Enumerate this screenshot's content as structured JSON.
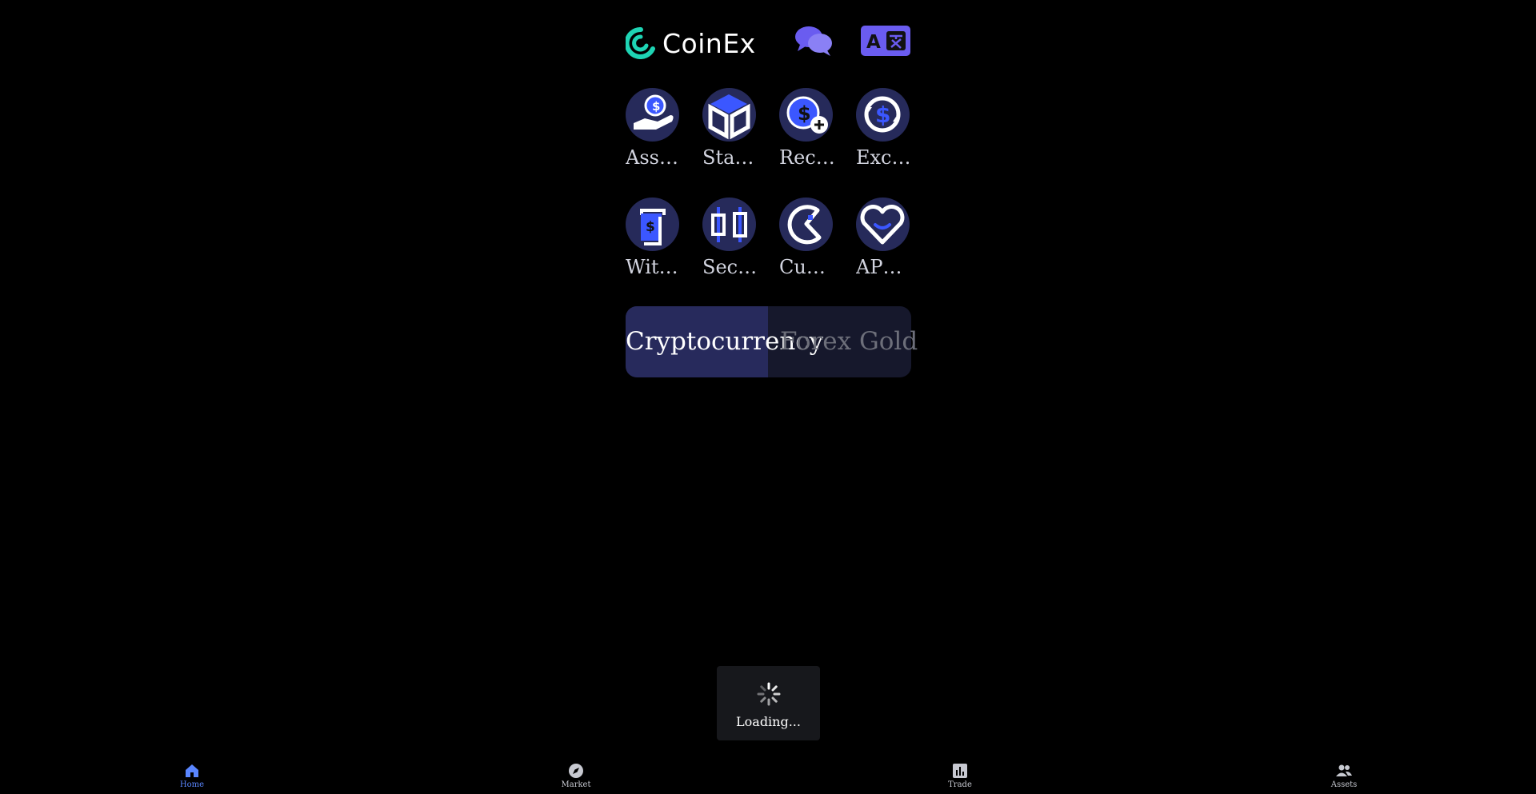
{
  "header": {
    "logo_text": "CoinEx",
    "logo_icon": "coinex-logo-icon",
    "chat_icon": "chat-bubbles-icon",
    "language_icon": "translate-icon"
  },
  "grid": {
    "items": [
      {
        "label": "Assets",
        "icon": "hand-coin-icon"
      },
      {
        "label": "Sta…",
        "icon": "cube-icon"
      },
      {
        "label": "Rec…",
        "icon": "coin-plus-icon"
      },
      {
        "label": "Exc…",
        "icon": "exchange-icon"
      },
      {
        "label": "Wit…",
        "icon": "withdraw-icon"
      },
      {
        "label": "Sec…",
        "icon": "candlestick-icon"
      },
      {
        "label": "Cus…",
        "icon": "pie-icon"
      },
      {
        "label": "AP…",
        "icon": "heart-icon"
      }
    ]
  },
  "tabs": {
    "items": [
      {
        "label": "Cryptocurrency",
        "active": true
      },
      {
        "label": "Forex Gold",
        "active": false
      }
    ]
  },
  "loading": {
    "text": "Loading..."
  },
  "bottom_nav": {
    "items": [
      {
        "label": "Home",
        "icon": "home-icon",
        "active": true
      },
      {
        "label": "Market",
        "icon": "compass-icon",
        "active": false
      },
      {
        "label": "Trade",
        "icon": "chart-icon",
        "active": false
      },
      {
        "label": "Assets",
        "icon": "users-icon",
        "active": false
      }
    ]
  },
  "colors": {
    "background": "#000000",
    "accent": "#5a86ff",
    "brand_teal": "#1ed4b4",
    "icon_blue": "#3b57ff",
    "tile_bg": "#262a5a"
  }
}
